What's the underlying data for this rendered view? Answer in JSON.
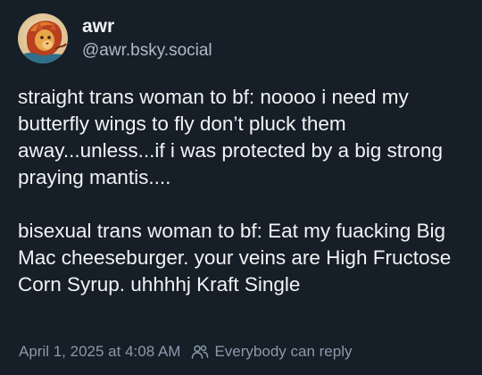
{
  "author": {
    "display_name": "awr",
    "handle": "@awr.bsky.social"
  },
  "post": {
    "paragraphs": [
      "straight trans woman to bf: noooo i need my butterfly wings to fly don’t pluck them away...unless...if i was protected by a big strong praying mantis....",
      "bisexual trans woman to bf: Eat my fuacking Big Mac cheeseburger. your veins are High Fructose Corn Syrup. uhhhhj Kraft Single"
    ],
    "timestamp": "April 1, 2025 at 4:08 AM",
    "reply_setting": "Everybody can reply"
  },
  "icons": {
    "reply_setting_icon": "people-icon"
  },
  "colors": {
    "background": "#161e27",
    "text_primary": "#f1f3f5",
    "text_secondary": "#aebbc9",
    "text_meta": "#8a9aac"
  }
}
